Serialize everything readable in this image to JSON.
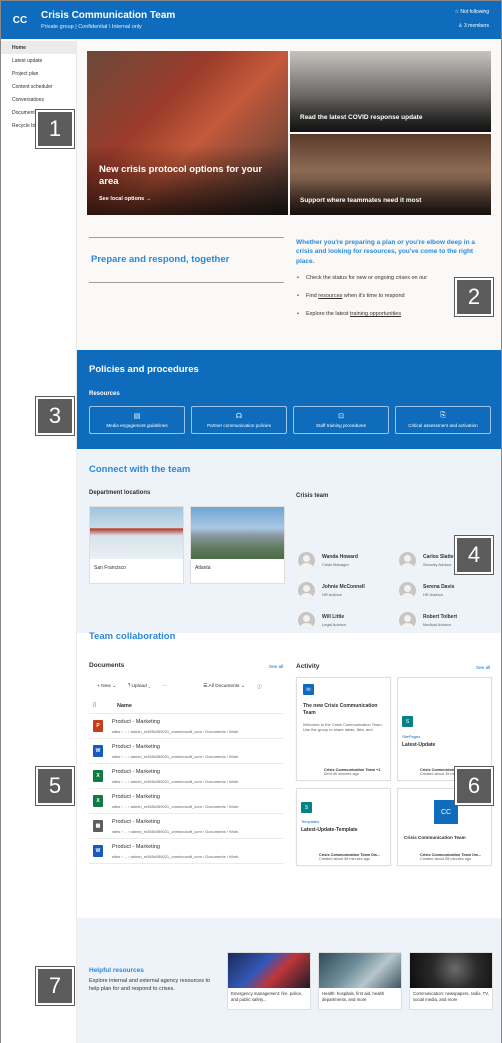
{
  "header": {
    "logo": "CC",
    "title": "Crisis Communication Team",
    "subtitle": "Private group | Confidential \\ Internal only",
    "follow": "☆ Not following",
    "members": "♙ 3 members"
  },
  "nav": {
    "items": [
      "Home",
      "Latest update",
      "Project plan",
      "Content scheduler",
      "Conversations",
      "Documents",
      "Recycle bin"
    ]
  },
  "hero": {
    "main_caption": "New crisis protocol options for your area",
    "main_link": "See local options →",
    "top_right_caption": "Read the latest COVID response update",
    "bottom_right_caption": "Support where teammates need it most"
  },
  "prepare": {
    "title": "Prepare and respond, together",
    "quote": "Whether you're preparing a plan or you're elbow deep in a crisis and looking for resources, you've come to the right place.",
    "bullet1": "Check the status for new or ongoing crises on our",
    "bullet2_pre": "Find ",
    "bullet2_link": "resources",
    "bullet2_post": " when it's time to respond",
    "bullet3_pre": "Explore the latest ",
    "bullet3_link": "training opportunities"
  },
  "policies": {
    "title": "Policies and procedures",
    "subtitle": "Resources",
    "buttons": [
      "Media engagement guidelines",
      "Partner communication policies",
      "Staff training procedures",
      "Critical assessment and activation"
    ]
  },
  "connect": {
    "title": "Connect with the team",
    "dept_title": "Department locations",
    "locations": [
      "San Francisco",
      "Atlanta"
    ],
    "team_title": "Crisis team",
    "people": [
      {
        "name": "Wanda Howard",
        "role": "Crisis Manager"
      },
      {
        "name": "Carlos Slattery",
        "role": "Security Advisor"
      },
      {
        "name": "Johnie McConnell",
        "role": "HR Advisor"
      },
      {
        "name": "Serena Davis",
        "role": "HR Advisor"
      },
      {
        "name": "Will Little",
        "role": "Legal Advisor"
      },
      {
        "name": "Robert Tolbert",
        "role": "Medical Advisor"
      }
    ]
  },
  "collab": {
    "title": "Team collaboration",
    "docs_title": "Documents",
    "see_all": "See all",
    "toolbar": {
      "new": "+ New ⌄",
      "upload": "⤒ Upload ⌄",
      "more": "···",
      "view": "☰ All Documents ⌄",
      "info": "ⓘ"
    },
    "name_header": "Name",
    "docs": [
      {
        "name": "Product - Marketing",
        "path": "sites › ... › admin_m365x059021_onmicrosoft_com › Documents › Work",
        "type": "P",
        "color": "#c43e1c"
      },
      {
        "name": "Product - Marketing",
        "path": "sites › ... › admin_m365x059021_onmicrosoft_com › Documents › Work",
        "type": "W",
        "color": "#185abd"
      },
      {
        "name": "Product - Marketing",
        "path": "sites › ... › admin_m365x059021_onmicrosoft_com › Documents › Work",
        "type": "X",
        "color": "#107c41"
      },
      {
        "name": "Product - Marketing",
        "path": "sites › ... › admin_m365x059021_onmicrosoft_com › Documents › Work",
        "type": "X",
        "color": "#107c41"
      },
      {
        "name": "Product - Marketing",
        "path": "sites › ... › admin_m365x059021_onmicrosoft_com › Documents › Work",
        "type": "▦",
        "color": "#605e5c"
      },
      {
        "name": "Product - Marketing",
        "path": "sites › ... › admin_m365x059021_onmicrosoft_com › Documents › Work",
        "type": "W",
        "color": "#185abd"
      }
    ],
    "activity_title": "Activity",
    "activity": [
      {
        "label": "",
        "title": "The new Crisis Communication Team",
        "desc": "Welcome to the Crisis Communication Team. Use the group to share ideas, files, and",
        "author": "Crisis Communication Team +1",
        "time": "Sent 46 minutes ago"
      },
      {
        "label": "SitePages",
        "title": "Latest-Update",
        "desc": "",
        "author": "Crisis Communication Team",
        "time": "Created about 35 minutes ago"
      },
      {
        "label": "Templates",
        "title": "Latest-Update-Template",
        "desc": "",
        "author": "Crisis Communication Team Ow...",
        "time": "Created about 58 minutes ago"
      },
      {
        "label": "CC",
        "title": "Crisis Communication Team",
        "desc": "",
        "author": "Crisis Communication Team Ow...",
        "time": "Created about 58 minutes ago"
      }
    ]
  },
  "helpful": {
    "title": "Helpful resources",
    "text": "Explore internal and external agency resources to help plan for and respond to crises.",
    "cards": [
      "Emergency management: fire, police, and public safety...",
      "Health: hospitals, first aid, health departments, and more",
      "Communication: newspapers, radio, TV, social media, and more"
    ]
  },
  "markers": [
    "1",
    "2",
    "3",
    "4",
    "5",
    "6",
    "7"
  ]
}
